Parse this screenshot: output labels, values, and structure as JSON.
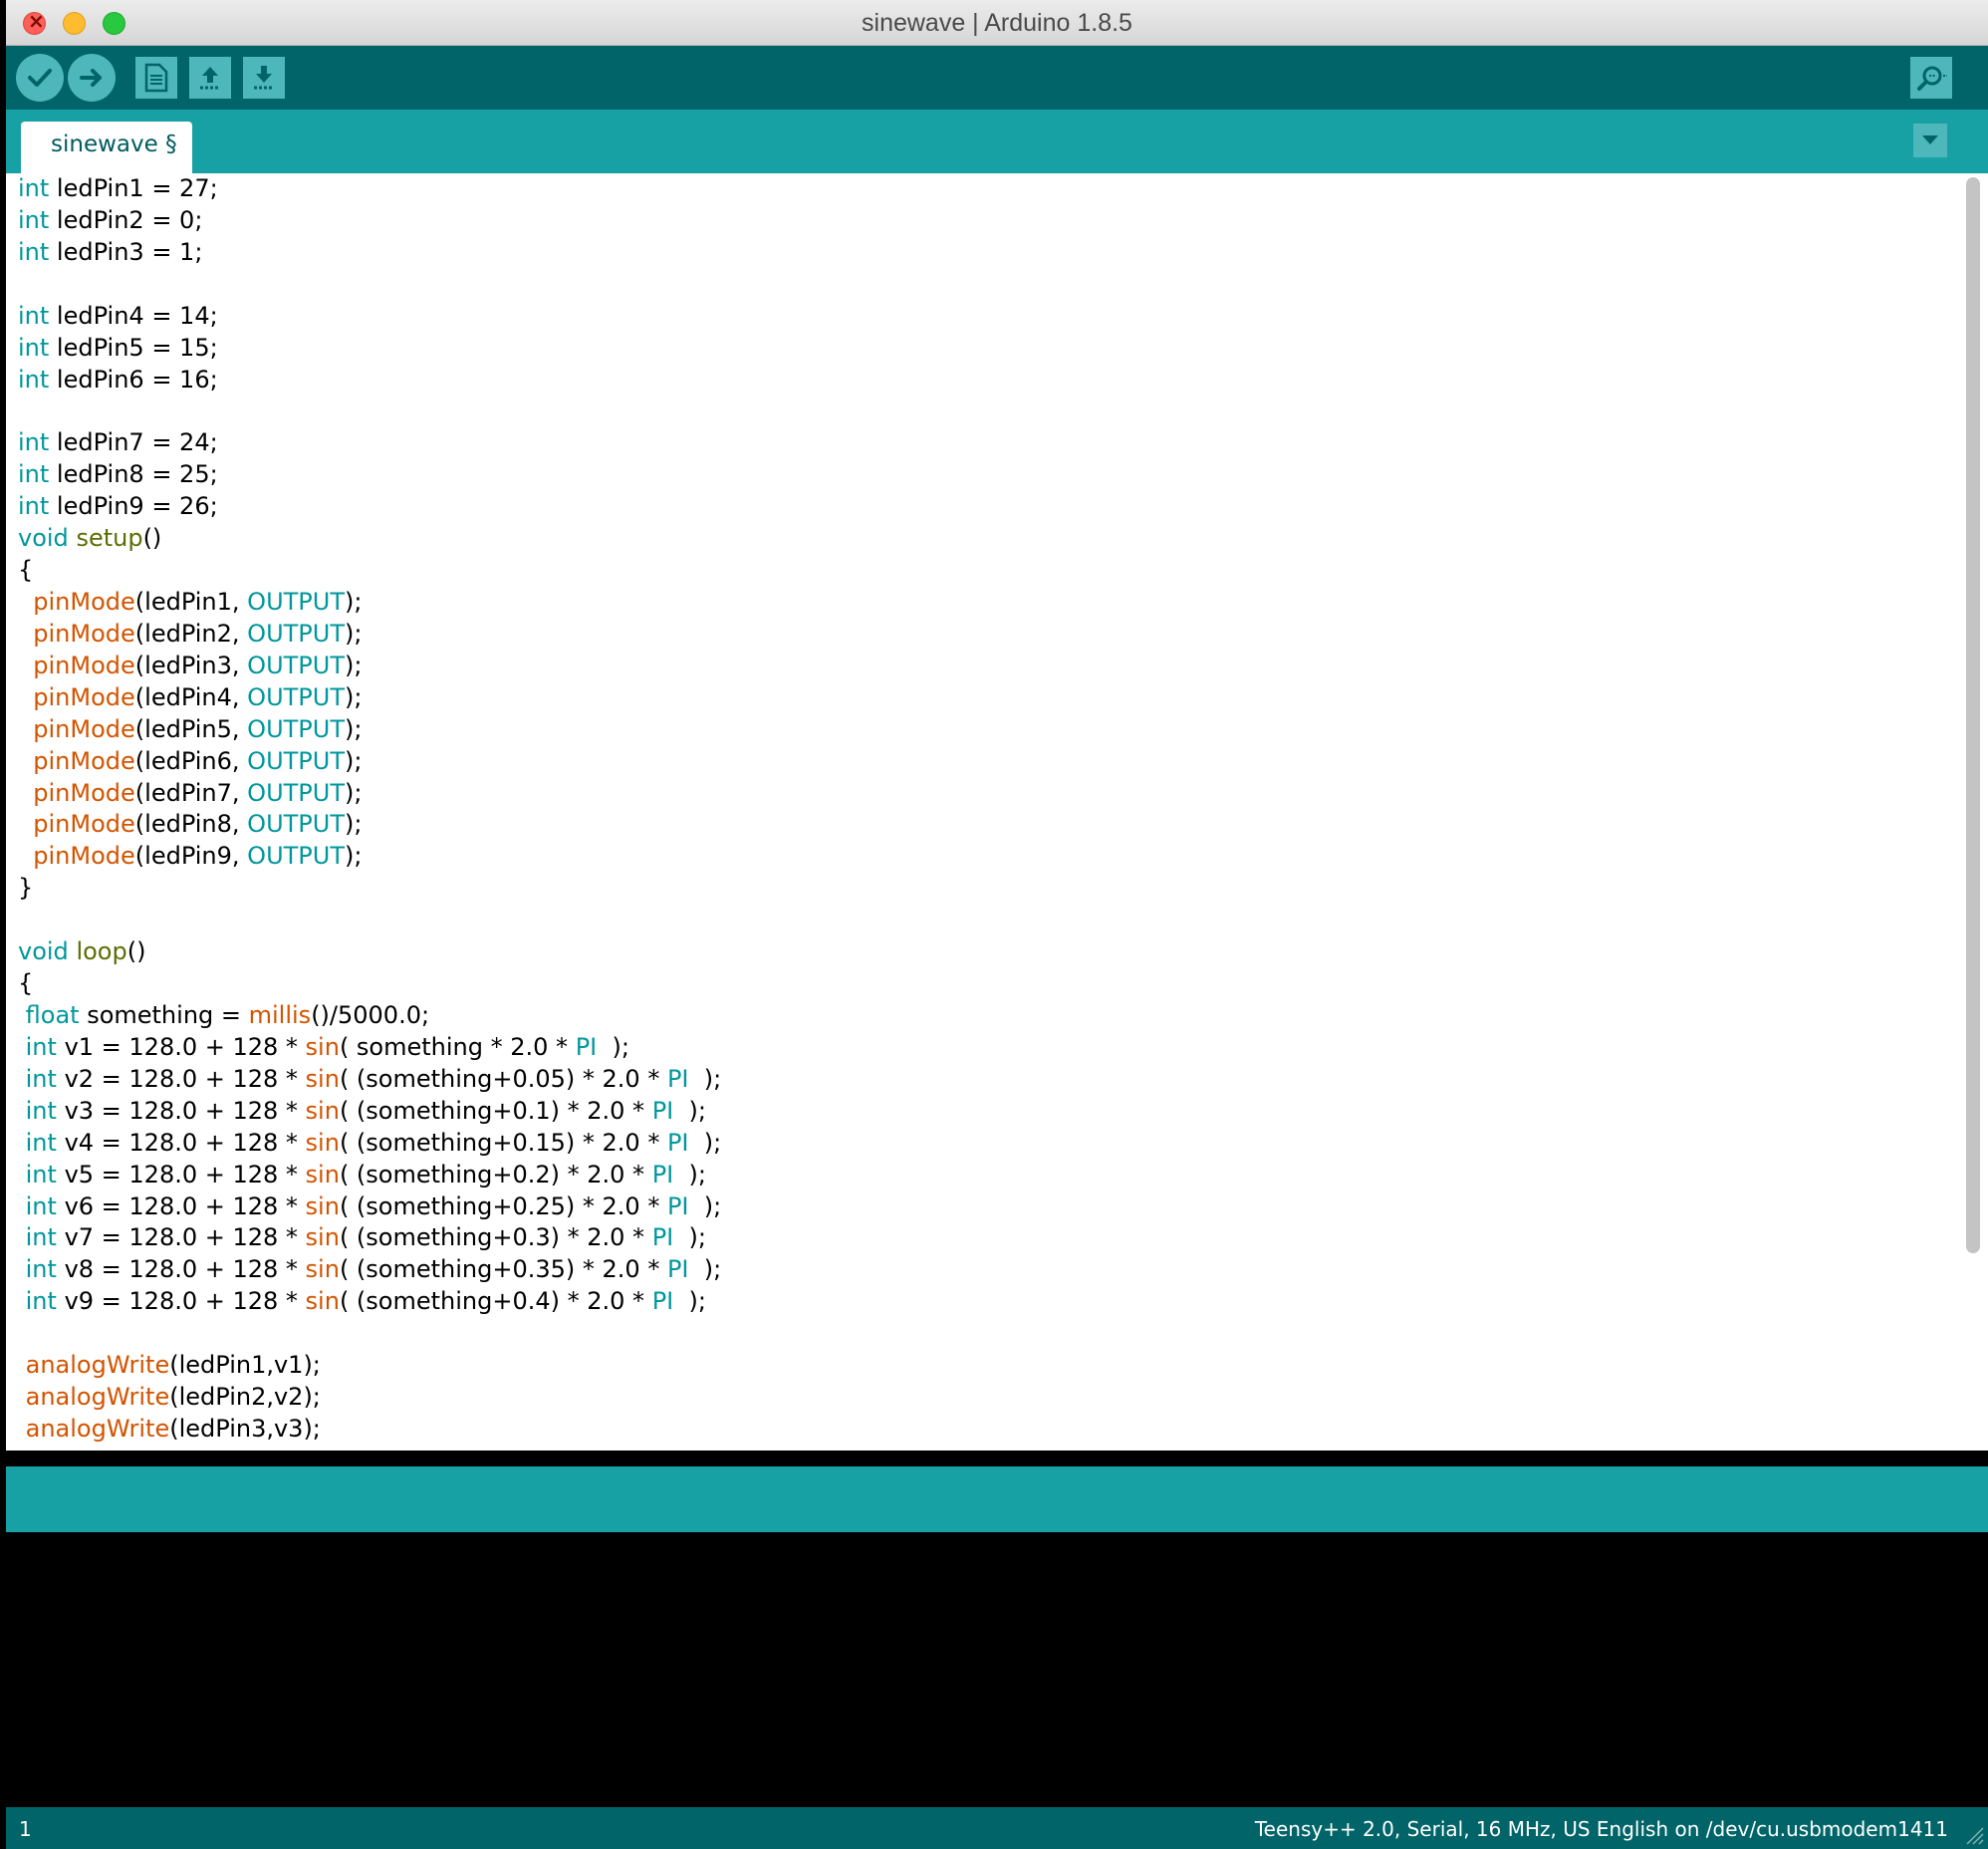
{
  "window": {
    "title": "sinewave | Arduino 1.8.5"
  },
  "toolbar": {
    "verify_icon": "checkmark-icon",
    "upload_icon": "arrow-right-icon",
    "new_icon": "new-document-icon",
    "open_icon": "open-arrow-up-icon",
    "save_icon": "save-arrow-down-icon",
    "serial_monitor_icon": "magnifier-icon"
  },
  "tabs": [
    {
      "label": "sinewave §"
    }
  ],
  "colors": {
    "toolbar_bg": "#006468",
    "tabbar_bg": "#17a1a5",
    "button_bg": "#4db7bb",
    "type_keyword": "#00979c",
    "function_name": "#5e6d03",
    "builtin_call": "#d35400"
  },
  "code_lines": [
    [
      {
        "t": "int",
        "c": "kw-type"
      },
      {
        "t": " ledPin1 = 27;"
      }
    ],
    [
      {
        "t": "int",
        "c": "kw-type"
      },
      {
        "t": " ledPin2 = 0;"
      }
    ],
    [
      {
        "t": "int",
        "c": "kw-type"
      },
      {
        "t": " ledPin3 = 1;"
      }
    ],
    [
      {
        "t": ""
      }
    ],
    [
      {
        "t": "int",
        "c": "kw-type"
      },
      {
        "t": " ledPin4 = 14;"
      }
    ],
    [
      {
        "t": "int",
        "c": "kw-type"
      },
      {
        "t": " ledPin5 = 15;"
      }
    ],
    [
      {
        "t": "int",
        "c": "kw-type"
      },
      {
        "t": " ledPin6 = 16;"
      }
    ],
    [
      {
        "t": ""
      }
    ],
    [
      {
        "t": "int",
        "c": "kw-type"
      },
      {
        "t": " ledPin7 = 24;"
      }
    ],
    [
      {
        "t": "int",
        "c": "kw-type"
      },
      {
        "t": " ledPin8 = 25;"
      }
    ],
    [
      {
        "t": "int",
        "c": "kw-type"
      },
      {
        "t": " ledPin9 = 26;"
      }
    ],
    [
      {
        "t": "void",
        "c": "kw-type"
      },
      {
        "t": " "
      },
      {
        "t": "setup",
        "c": "kw-fn"
      },
      {
        "t": "()"
      }
    ],
    [
      {
        "t": "{"
      }
    ],
    [
      {
        "t": "  "
      },
      {
        "t": "pinMode",
        "c": "kw-call"
      },
      {
        "t": "(ledPin1, "
      },
      {
        "t": "OUTPUT",
        "c": "kw-const"
      },
      {
        "t": ");"
      }
    ],
    [
      {
        "t": "  "
      },
      {
        "t": "pinMode",
        "c": "kw-call"
      },
      {
        "t": "(ledPin2, "
      },
      {
        "t": "OUTPUT",
        "c": "kw-const"
      },
      {
        "t": ");"
      }
    ],
    [
      {
        "t": "  "
      },
      {
        "t": "pinMode",
        "c": "kw-call"
      },
      {
        "t": "(ledPin3, "
      },
      {
        "t": "OUTPUT",
        "c": "kw-const"
      },
      {
        "t": ");"
      }
    ],
    [
      {
        "t": "  "
      },
      {
        "t": "pinMode",
        "c": "kw-call"
      },
      {
        "t": "(ledPin4, "
      },
      {
        "t": "OUTPUT",
        "c": "kw-const"
      },
      {
        "t": ");"
      }
    ],
    [
      {
        "t": "  "
      },
      {
        "t": "pinMode",
        "c": "kw-call"
      },
      {
        "t": "(ledPin5, "
      },
      {
        "t": "OUTPUT",
        "c": "kw-const"
      },
      {
        "t": ");"
      }
    ],
    [
      {
        "t": "  "
      },
      {
        "t": "pinMode",
        "c": "kw-call"
      },
      {
        "t": "(ledPin6, "
      },
      {
        "t": "OUTPUT",
        "c": "kw-const"
      },
      {
        "t": ");"
      }
    ],
    [
      {
        "t": "  "
      },
      {
        "t": "pinMode",
        "c": "kw-call"
      },
      {
        "t": "(ledPin7, "
      },
      {
        "t": "OUTPUT",
        "c": "kw-const"
      },
      {
        "t": ");"
      }
    ],
    [
      {
        "t": "  "
      },
      {
        "t": "pinMode",
        "c": "kw-call"
      },
      {
        "t": "(ledPin8, "
      },
      {
        "t": "OUTPUT",
        "c": "kw-const"
      },
      {
        "t": ");"
      }
    ],
    [
      {
        "t": "  "
      },
      {
        "t": "pinMode",
        "c": "kw-call"
      },
      {
        "t": "(ledPin9, "
      },
      {
        "t": "OUTPUT",
        "c": "kw-const"
      },
      {
        "t": ");"
      }
    ],
    [
      {
        "t": "}"
      }
    ],
    [
      {
        "t": ""
      }
    ],
    [
      {
        "t": "void",
        "c": "kw-type"
      },
      {
        "t": " "
      },
      {
        "t": "loop",
        "c": "kw-fn"
      },
      {
        "t": "()"
      }
    ],
    [
      {
        "t": "{"
      }
    ],
    [
      {
        "t": " "
      },
      {
        "t": "float",
        "c": "kw-type"
      },
      {
        "t": " something = "
      },
      {
        "t": "millis",
        "c": "kw-call"
      },
      {
        "t": "()/5000.0;"
      }
    ],
    [
      {
        "t": " "
      },
      {
        "t": "int",
        "c": "kw-type"
      },
      {
        "t": " v1 = 128.0 + 128 * "
      },
      {
        "t": "sin",
        "c": "kw-call"
      },
      {
        "t": "( something * 2.0 * "
      },
      {
        "t": "PI",
        "c": "kw-const"
      },
      {
        "t": "  );"
      }
    ],
    [
      {
        "t": " "
      },
      {
        "t": "int",
        "c": "kw-type"
      },
      {
        "t": " v2 = 128.0 + 128 * "
      },
      {
        "t": "sin",
        "c": "kw-call"
      },
      {
        "t": "( (something+0.05) * 2.0 * "
      },
      {
        "t": "PI",
        "c": "kw-const"
      },
      {
        "t": "  );"
      }
    ],
    [
      {
        "t": " "
      },
      {
        "t": "int",
        "c": "kw-type"
      },
      {
        "t": " v3 = 128.0 + 128 * "
      },
      {
        "t": "sin",
        "c": "kw-call"
      },
      {
        "t": "( (something+0.1) * 2.0 * "
      },
      {
        "t": "PI",
        "c": "kw-const"
      },
      {
        "t": "  );"
      }
    ],
    [
      {
        "t": " "
      },
      {
        "t": "int",
        "c": "kw-type"
      },
      {
        "t": " v4 = 128.0 + 128 * "
      },
      {
        "t": "sin",
        "c": "kw-call"
      },
      {
        "t": "( (something+0.15) * 2.0 * "
      },
      {
        "t": "PI",
        "c": "kw-const"
      },
      {
        "t": "  );"
      }
    ],
    [
      {
        "t": " "
      },
      {
        "t": "int",
        "c": "kw-type"
      },
      {
        "t": " v5 = 128.0 + 128 * "
      },
      {
        "t": "sin",
        "c": "kw-call"
      },
      {
        "t": "( (something+0.2) * 2.0 * "
      },
      {
        "t": "PI",
        "c": "kw-const"
      },
      {
        "t": "  );"
      }
    ],
    [
      {
        "t": " "
      },
      {
        "t": "int",
        "c": "kw-type"
      },
      {
        "t": " v6 = 128.0 + 128 * "
      },
      {
        "t": "sin",
        "c": "kw-call"
      },
      {
        "t": "( (something+0.25) * 2.0 * "
      },
      {
        "t": "PI",
        "c": "kw-const"
      },
      {
        "t": "  );"
      }
    ],
    [
      {
        "t": " "
      },
      {
        "t": "int",
        "c": "kw-type"
      },
      {
        "t": " v7 = 128.0 + 128 * "
      },
      {
        "t": "sin",
        "c": "kw-call"
      },
      {
        "t": "( (something+0.3) * 2.0 * "
      },
      {
        "t": "PI",
        "c": "kw-const"
      },
      {
        "t": "  );"
      }
    ],
    [
      {
        "t": " "
      },
      {
        "t": "int",
        "c": "kw-type"
      },
      {
        "t": " v8 = 128.0 + 128 * "
      },
      {
        "t": "sin",
        "c": "kw-call"
      },
      {
        "t": "( (something+0.35) * 2.0 * "
      },
      {
        "t": "PI",
        "c": "kw-const"
      },
      {
        "t": "  );"
      }
    ],
    [
      {
        "t": " "
      },
      {
        "t": "int",
        "c": "kw-type"
      },
      {
        "t": " v9 = 128.0 + 128 * "
      },
      {
        "t": "sin",
        "c": "kw-call"
      },
      {
        "t": "( (something+0.4) * 2.0 * "
      },
      {
        "t": "PI",
        "c": "kw-const"
      },
      {
        "t": "  );"
      }
    ],
    [
      {
        "t": ""
      }
    ],
    [
      {
        "t": " "
      },
      {
        "t": "analogWrite",
        "c": "kw-call"
      },
      {
        "t": "(ledPin1,v1);"
      }
    ],
    [
      {
        "t": " "
      },
      {
        "t": "analogWrite",
        "c": "kw-call"
      },
      {
        "t": "(ledPin2,v2);"
      }
    ],
    [
      {
        "t": " "
      },
      {
        "t": "analogWrite",
        "c": "kw-call"
      },
      {
        "t": "(ledPin3,v3);"
      }
    ]
  ],
  "footer": {
    "line_number": "1",
    "board_info": "Teensy++ 2.0, Serial, 16 MHz, US English on /dev/cu.usbmodem1411"
  }
}
